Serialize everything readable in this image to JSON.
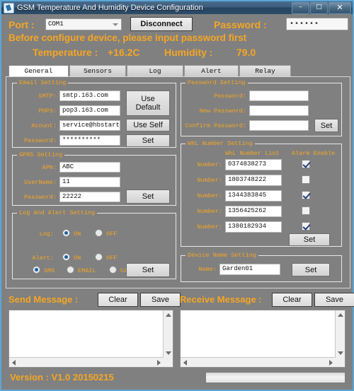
{
  "window": {
    "title": "GSM Temperature And Humidity Device Configuration",
    "icon": "app-icon",
    "controls": {
      "minimize": "–",
      "maximize": "□",
      "close": "✕"
    },
    "colors": {
      "accent_gold": "#f5a623",
      "background_gray": "#808080",
      "title_blue": "#2f7fb5"
    }
  },
  "topbar": {
    "port_label": "Port :",
    "port_value": "COM1",
    "connect_button": "Disconnect",
    "password_label": "Password :",
    "password_value": "••••••",
    "notice": "Before configure device, please input password first",
    "temperature_label": "Temperature :",
    "temperature_value": "+16.2C",
    "humidity_label": "Humidity :",
    "humidity_value": "79.0"
  },
  "tabs": [
    {
      "label": "General",
      "active": true
    },
    {
      "label": "Sensors",
      "active": false
    },
    {
      "label": "Log",
      "active": false
    },
    {
      "label": "Alert",
      "active": false
    },
    {
      "label": "Relay",
      "active": false
    }
  ],
  "email_setting": {
    "legend": "Email Setting",
    "fields": [
      {
        "label": "SMTP:",
        "value": "smtp.163.com"
      },
      {
        "label": "POP3:",
        "value": "pop3.163.com"
      },
      {
        "label": "Acount:",
        "value": "service@hbstart.c"
      },
      {
        "label": "Password:",
        "value": "**********"
      }
    ],
    "use_default_line1": "Use",
    "use_default_line2": "Default",
    "use_self": "Use Self",
    "set": "Set"
  },
  "gprs_setting": {
    "legend": "GPRS Setting",
    "fields": [
      {
        "label": "APN:",
        "value": "ABC"
      },
      {
        "label": "UserName:",
        "value": "11"
      },
      {
        "label": "Password:",
        "value": "22222"
      }
    ],
    "set": "Set"
  },
  "log_alert_setting": {
    "legend": "Log And Alert Setting",
    "log_label": "Log:",
    "log_on": "ON",
    "log_off": "OFF",
    "log_selected": "ON",
    "alert_label": "Alert:",
    "alert_on": "ON",
    "alert_off": "OFF",
    "alert_selected": "ON",
    "channel_sms": "SMS",
    "channel_email": "EMAIL",
    "channel_call": "CALL",
    "channel_selected": "SMS",
    "set": "Set"
  },
  "password_setting": {
    "legend": "Password Setting",
    "fields": [
      {
        "label": "Password:",
        "value": ""
      },
      {
        "label": "New Password:",
        "value": ""
      },
      {
        "label": "Confirm Password:",
        "value": ""
      }
    ],
    "set": "Set"
  },
  "whitelist_setting": {
    "legend": "WhL Number Setting",
    "col_number": "WhL Number List",
    "col_alarm": "Alarm Enable",
    "rows": [
      {
        "label": "Number:",
        "value": "0374838273",
        "enabled": true
      },
      {
        "label": "Number:",
        "value": "1803748222",
        "enabled": false
      },
      {
        "label": "Number:",
        "value": "1344383845",
        "enabled": true
      },
      {
        "label": "Number:",
        "value": "1356425262",
        "enabled": false
      },
      {
        "label": "Number:",
        "value": "1380182934",
        "enabled": true
      }
    ],
    "set": "Set"
  },
  "device_name_setting": {
    "legend": "Device Name Setting",
    "label": "Name:",
    "value": "Garden01",
    "set": "Set"
  },
  "send_message": {
    "title": "Send Message :",
    "clear": "Clear",
    "save": "Save",
    "content": ""
  },
  "receive_message": {
    "title": "Receive Message :",
    "clear": "Clear",
    "save": "Save",
    "content": ""
  },
  "status": {
    "version": "Version : V1.0 20150215",
    "progress_percent": 0
  }
}
